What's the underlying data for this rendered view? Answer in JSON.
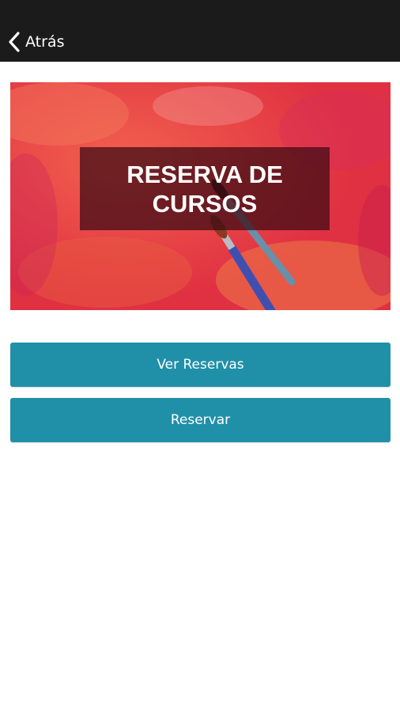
{
  "header": {
    "back_label": "Atrás",
    "back_icon": "chevron-left-icon"
  },
  "banner": {
    "title": "RESERVA DE CURSOS",
    "image": "paint-brushes-on-red-watercolor"
  },
  "actions": {
    "view_label": "Ver Reservas",
    "book_label": "Reservar"
  },
  "colors": {
    "topbar": "#1b1b1b",
    "button": "#2090a8",
    "banner_base": "#e7403f"
  }
}
